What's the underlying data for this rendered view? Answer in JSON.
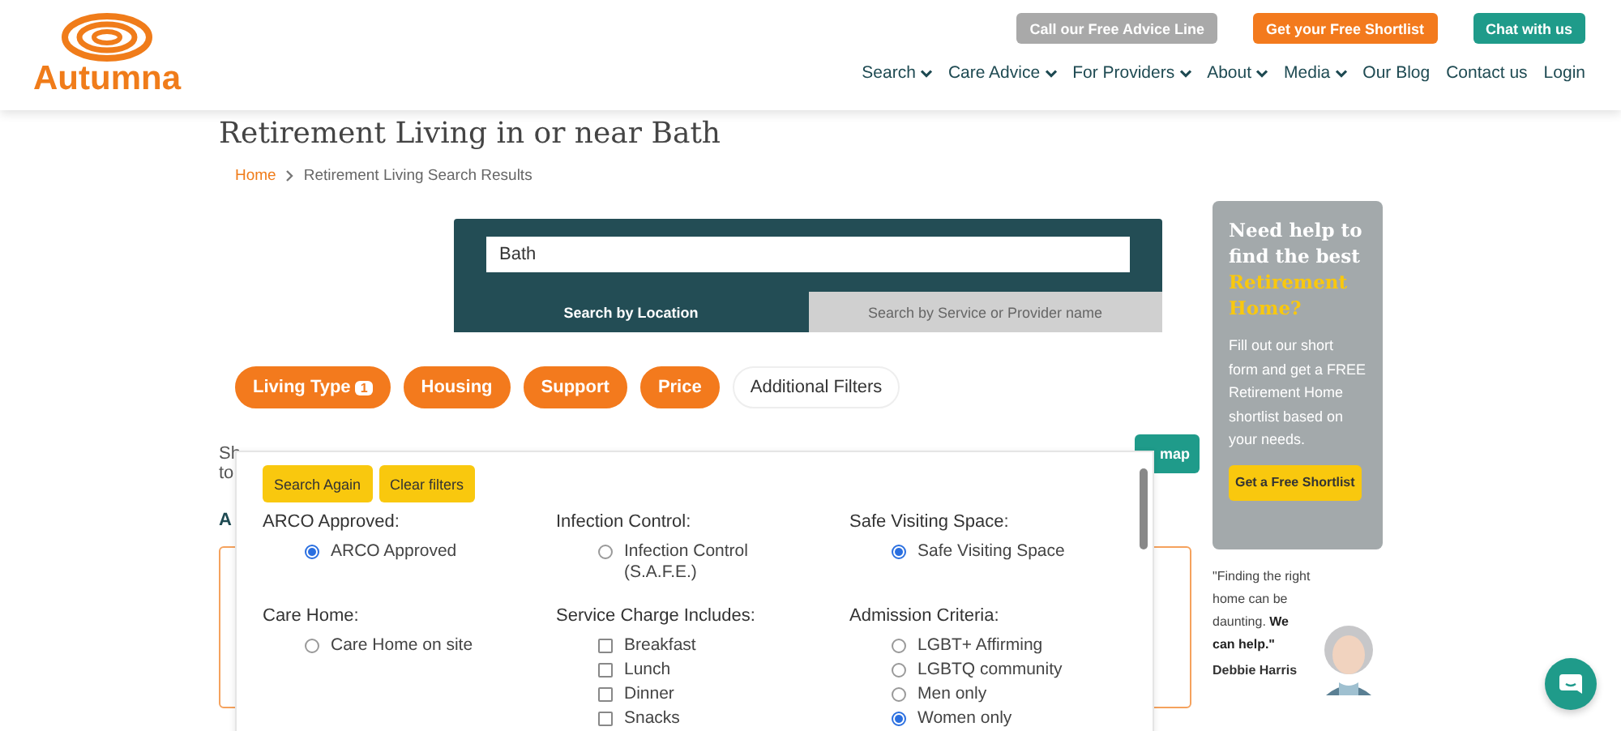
{
  "header": {
    "logo": "Autumna",
    "top_buttons": [
      {
        "label": "Call our Free Advice Line",
        "kind": "grey"
      },
      {
        "label": "Get your Free Shortlist",
        "kind": "orange"
      },
      {
        "label": "Chat with us",
        "kind": "teal"
      }
    ],
    "nav": [
      {
        "label": "Search",
        "dropdown": true
      },
      {
        "label": "Care Advice",
        "dropdown": true
      },
      {
        "label": "For Providers",
        "dropdown": true
      },
      {
        "label": "About",
        "dropdown": true
      },
      {
        "label": "Media",
        "dropdown": true
      },
      {
        "label": "Our Blog",
        "dropdown": false
      },
      {
        "label": "Contact us",
        "dropdown": false
      },
      {
        "label": "Login",
        "dropdown": false
      }
    ]
  },
  "page_title": "Retirement Living in or near Bath",
  "breadcrumb": [
    "Home",
    "Retirement Living Search Results"
  ],
  "search": {
    "value": "Bath",
    "tabs": [
      {
        "label": "Search by Location",
        "selected": true
      },
      {
        "label": "Search by Service or Provider name",
        "selected": false
      }
    ]
  },
  "filters": [
    {
      "label": "Living Type",
      "count": "1",
      "selected": true
    },
    {
      "label": "Housing",
      "selected": true
    },
    {
      "label": "Support",
      "selected": true
    },
    {
      "label": "Price",
      "selected": true
    },
    {
      "label": "Additional Filters",
      "selected": false
    }
  ],
  "behind": {
    "text_1": "Sh",
    "text_2": "to",
    "text_3": "A",
    "map_button": "map"
  },
  "dropdown": {
    "buttons": [
      "Search Again",
      "Clear filters"
    ],
    "groups": [
      {
        "title": "ARCO Approved:",
        "options": [
          {
            "label": "ARCO Approved",
            "kind": "radio",
            "checked": true
          }
        ]
      },
      {
        "title": "Infection Control:",
        "options": [
          {
            "label": "Infection Control (S.A.F.E.)",
            "kind": "radio",
            "checked": false
          }
        ]
      },
      {
        "title": "Safe Visiting Space:",
        "options": [
          {
            "label": "Safe Visiting Space",
            "kind": "radio",
            "checked": true
          }
        ]
      },
      {
        "title": "Care Home:",
        "options": [
          {
            "label": "Care Home on site",
            "kind": "radio",
            "checked": false
          }
        ]
      },
      {
        "title": "Service Charge Includes:",
        "options": [
          {
            "label": "Breakfast",
            "kind": "checkbox",
            "checked": false
          },
          {
            "label": "Lunch",
            "kind": "checkbox",
            "checked": false
          },
          {
            "label": "Dinner",
            "kind": "checkbox",
            "checked": false
          },
          {
            "label": "Snacks",
            "kind": "checkbox",
            "checked": false
          }
        ]
      },
      {
        "title": "Admission Criteria:",
        "options": [
          {
            "label": "LGBT+ Affirming",
            "kind": "radio",
            "checked": false
          },
          {
            "label": "LGBTQ community",
            "kind": "radio",
            "checked": false
          },
          {
            "label": "Men only",
            "kind": "radio",
            "checked": false
          },
          {
            "label": "Women only",
            "kind": "radio",
            "checked": true
          }
        ]
      }
    ]
  },
  "sidebar": {
    "heading": "Need help to find the best",
    "heading_highlight": "Retirement Home?",
    "text": "Fill out our short form and get a FREE Retirement Home shortlist based on your needs.",
    "button": "Get a Free Shortlist",
    "quote": "\"Finding the right home can be daunting.",
    "quote_bold": "We can help.\"",
    "person": "Debbie Harris"
  }
}
